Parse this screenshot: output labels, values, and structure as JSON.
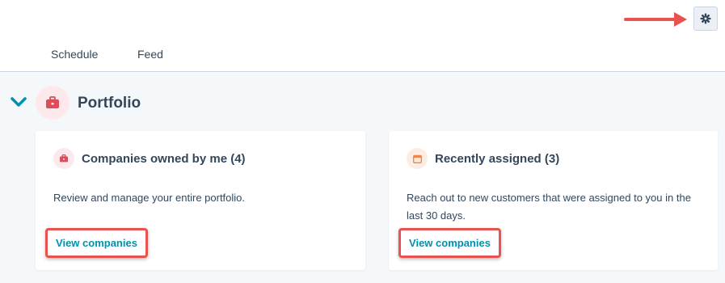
{
  "tabs": [
    {
      "label": "Schedule"
    },
    {
      "label": "Feed"
    }
  ],
  "settings": {
    "icon": "gear-icon"
  },
  "section": {
    "title": "Portfolio",
    "icon": "briefcase-icon"
  },
  "cards": [
    {
      "icon": "briefcase-icon",
      "title": "Companies owned by me (4)",
      "description": "Review and manage your entire portfolio.",
      "link_label": "View companies"
    },
    {
      "icon": "calendar-icon",
      "title": "Recently assigned (3)",
      "description": "Reach out to new customers that were assigned to you in the last 30 days.",
      "link_label": "View companies"
    }
  ],
  "colors": {
    "accent_link": "#0091ae",
    "annotation": "#e8534f",
    "text": "#33475b",
    "briefcase": "#e04b5a",
    "calendar": "#f0864a"
  }
}
